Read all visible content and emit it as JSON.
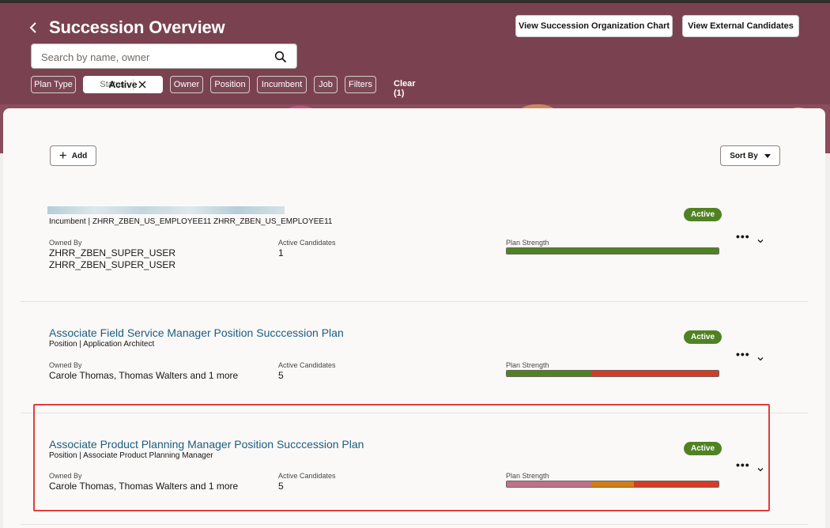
{
  "header": {
    "title": "Succession Overview",
    "view_org_chart": "View Succession Organization Chart",
    "view_external": "View External Candidates"
  },
  "search": {
    "placeholder": "Search by name, owner"
  },
  "filters": {
    "plan_type": "Plan Type",
    "status_label": "Status",
    "status_value": "Active",
    "owner": "Owner",
    "position": "Position",
    "incumbent": "Incumbent",
    "job": "Job",
    "filters": "Filters",
    "clear": "Clear (1)"
  },
  "toolbar": {
    "add": "Add",
    "sort": "Sort By"
  },
  "labels": {
    "owned_by": "Owned By",
    "active_candidates": "Active Candidates",
    "plan_strength": "Plan Strength"
  },
  "plans": [
    {
      "title": "",
      "subtitle": "Incumbent | ZHRR_ZBEN_US_EMPLOYEE11 ZHRR_ZBEN_US_EMPLOYEE11",
      "owner_line1": "ZHRR_ZBEN_SUPER_USER",
      "owner_line2": "ZHRR_ZBEN_SUPER_USER",
      "candidates": "1",
      "status": "Active",
      "strength": [
        {
          "color": "#508223",
          "fraction": 1.0
        }
      ]
    },
    {
      "title": "Associate Field Service Manager Position Succcession Plan",
      "subtitle": "Position | Application Architect",
      "owner_line1": "Carole Thomas, Thomas Walters and 1 more",
      "owner_line2": "",
      "candidates": "5",
      "status": "Active",
      "strength": [
        {
          "color": "#508223",
          "fraction": 0.4
        },
        {
          "color": "#d63b25",
          "fraction": 0.6
        }
      ]
    },
    {
      "title": "Associate Product Planning Manager Position Succcession Plan",
      "subtitle": "Position | Associate Product Planning Manager",
      "owner_line1": "Carole Thomas, Thomas Walters and 1 more",
      "owner_line2": "",
      "candidates": "5",
      "status": "Active",
      "strength": [
        {
          "color": "#c0718a",
          "fraction": 0.4
        },
        {
          "color": "#d07f17",
          "fraction": 0.2
        },
        {
          "color": "#d63b25",
          "fraction": 0.4
        }
      ]
    }
  ]
}
